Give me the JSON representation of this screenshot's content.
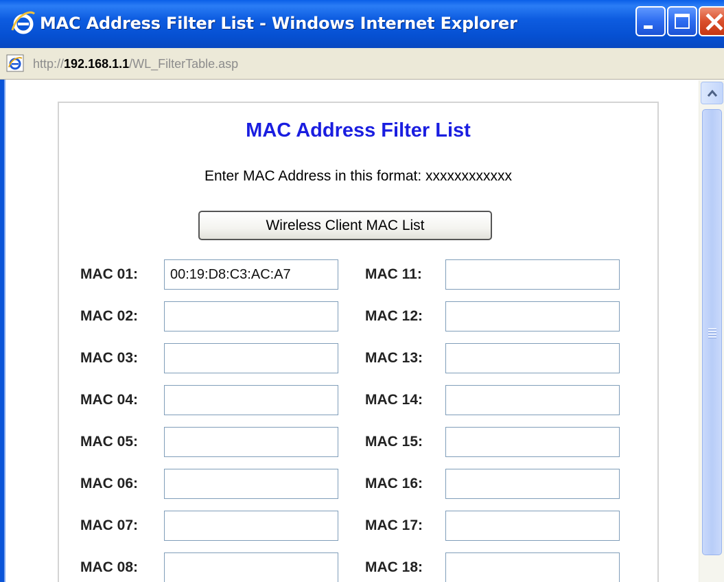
{
  "window": {
    "title": "MAC Address Filter List - Windows Internet Explorer",
    "title_bar_color": "#0a5fe8",
    "close_button_color": "#da4f2b"
  },
  "address_bar": {
    "scheme": "http://",
    "host": "192.168.1.1",
    "path": "/WL_FilterTable.asp"
  },
  "page": {
    "title": "MAC Address Filter List",
    "title_color": "#1a1ee0",
    "instruction": "Enter MAC Address in this format: xxxxxxxxxxxx",
    "client_list_button": "Wireless Client MAC List",
    "mac_entries": [
      {
        "label": "MAC 01:",
        "value": "00:19:D8:C3:AC:A7"
      },
      {
        "label": "MAC 02:",
        "value": ""
      },
      {
        "label": "MAC 03:",
        "value": ""
      },
      {
        "label": "MAC 04:",
        "value": ""
      },
      {
        "label": "MAC 05:",
        "value": ""
      },
      {
        "label": "MAC 06:",
        "value": ""
      },
      {
        "label": "MAC 07:",
        "value": ""
      },
      {
        "label": "MAC 08:",
        "value": ""
      },
      {
        "label": "MAC 11:",
        "value": ""
      },
      {
        "label": "MAC 12:",
        "value": ""
      },
      {
        "label": "MAC 13:",
        "value": ""
      },
      {
        "label": "MAC 14:",
        "value": ""
      },
      {
        "label": "MAC 15:",
        "value": ""
      },
      {
        "label": "MAC 16:",
        "value": ""
      },
      {
        "label": "MAC 17:",
        "value": ""
      },
      {
        "label": "MAC 18:",
        "value": ""
      }
    ]
  },
  "icons": {
    "title_icon": "ie-logo-icon",
    "address_icon": "ie-page-icon",
    "minimize": "minimize-icon",
    "maximize": "maximize-icon",
    "close": "close-icon",
    "scroll_up": "chevron-up-icon"
  }
}
